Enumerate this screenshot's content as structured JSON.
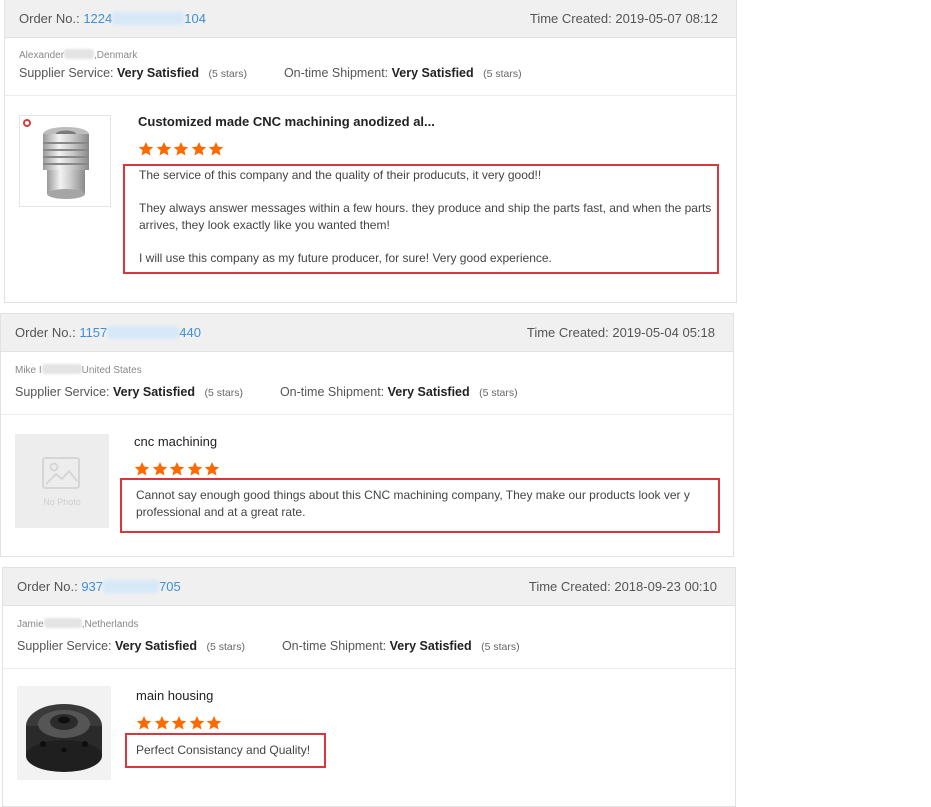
{
  "reviews": [
    {
      "order_label": "Order No.:",
      "order_prefix": "1224",
      "order_suffix": "104",
      "time_created": "Time Created: 2019-05-07 08:12",
      "buyer_first": "Alexander",
      "buyer_country": ",Denmark",
      "supplier_label": "Supplier Service:",
      "supplier_value": "Very Satisfied",
      "supplier_stars": "(5 stars)",
      "shipment_label": "On-time Shipment:",
      "shipment_value": "Very Satisfied",
      "shipment_stars": "(5 stars)",
      "product_name": "Customized made CNC machining anodized al...",
      "rating": 5,
      "review_paragraphs": [
        "The service of this company and the quality of their producuts, it very good!!",
        "They always answer messages within a few hours. they produce and ship the parts fast, and when the parts arrives, they look exactly like you wanted them!",
        "I will use this company as my future producer, for sure! Very good experience."
      ],
      "thumbnail": "cnc-anodized-part-photo"
    },
    {
      "order_label": "Order No.:",
      "order_prefix": "1157",
      "order_suffix": "440",
      "time_created": "Time Created: 2019-05-04 05:18",
      "buyer_first": "Mike I",
      "buyer_country": "United States",
      "supplier_label": "Supplier Service:",
      "supplier_value": "Very Satisfied",
      "supplier_stars": "(5 stars)",
      "shipment_label": "On-time Shipment:",
      "shipment_value": "Very Satisfied",
      "shipment_stars": "(5 stars)",
      "product_name": "cnc machining",
      "rating": 5,
      "review_paragraphs": [
        "Cannot say enough good things about this CNC machining company, They make our products look ver y professional and at a great rate."
      ],
      "thumbnail": "no-photo-placeholder",
      "no_photo_text": "No Photo"
    },
    {
      "order_label": "Order No.:",
      "order_prefix": "937",
      "order_suffix": "705",
      "time_created": "Time Created: 2018-09-23 00:10",
      "buyer_first": "Jamie",
      "buyer_country": ",Netherlands",
      "supplier_label": "Supplier Service:",
      "supplier_value": "Very Satisfied",
      "supplier_stars": "(5 stars)",
      "shipment_label": "On-time Shipment:",
      "shipment_value": "Very Satisfied",
      "shipment_stars": "(5 stars)",
      "product_name": "main housing",
      "rating": 5,
      "review_paragraphs": [
        "Perfect Consistancy and Quality!"
      ],
      "thumbnail": "black-housing-part-photo"
    }
  ],
  "colors": {
    "order_link": "#3d8fdc",
    "star": "#ff6a00",
    "highlight_box": "#d9363e",
    "header_bg": "#f0f0f0"
  }
}
